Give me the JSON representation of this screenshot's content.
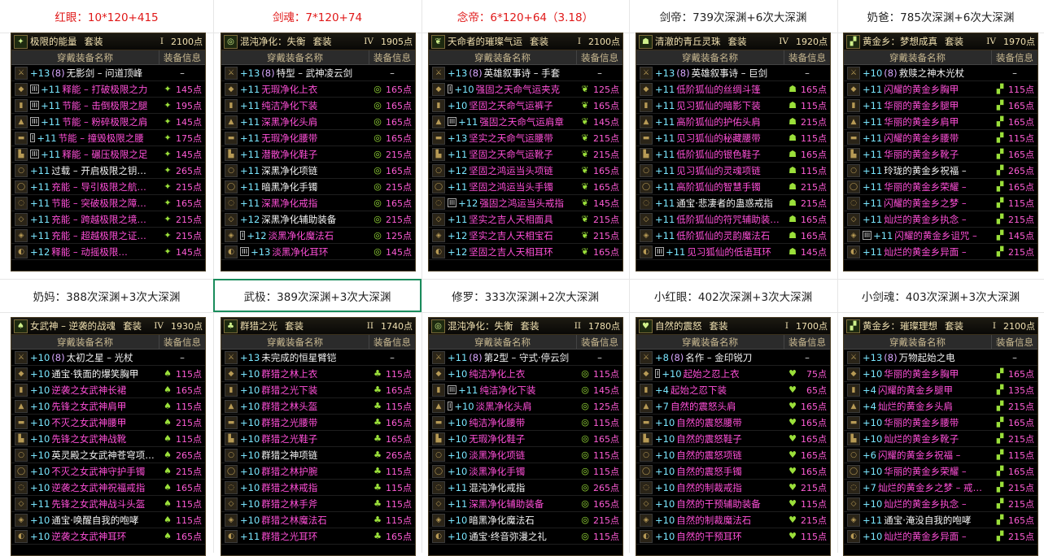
{
  "headers_top": [
    {
      "text": "红眼：10*120+415",
      "red": true
    },
    {
      "text": "剑魂：7*120+74",
      "red": true
    },
    {
      "text": "念帝：6*120+64（3.18）",
      "red": true
    },
    {
      "text": "剑帝：739次深渊+6次大深渊",
      "red": false
    },
    {
      "text": "奶爸：785次深渊+6次大深渊",
      "red": false
    }
  ],
  "headers_mid": [
    {
      "text": "奶妈：388次深渊+3次大深渊",
      "red": false
    },
    {
      "text": "武极：389次深渊+3次大深渊",
      "red": false,
      "selected": true
    },
    {
      "text": "修罗：333次深渊+2次大深渊",
      "red": false
    },
    {
      "text": "小红眼：402次深渊+3次大深渊",
      "red": false
    },
    {
      "text": "小剑魂：403次深渊+3次大深渊",
      "red": false
    }
  ],
  "columns": {
    "name": "穿戴装备名称",
    "info": "装备信息"
  },
  "colors": {
    "set_green": "#9be03a",
    "pink": "#ff4fd8",
    "gold": "#f0e0b0",
    "cyan": "#7ae6ff"
  },
  "panels": [
    {
      "title": "极限的能量",
      "tag": "套装",
      "grade": "I",
      "points": "2100点",
      "icon": "energy-set-icon",
      "rows": [
        {
          "enh": "+13",
          "amp": "(8)",
          "name": "无影剑 – 问道顶峰",
          "color": "white",
          "pts": "–"
        },
        {
          "badge": "III",
          "enh": "+11",
          "name": "释能 – 打破极限之力",
          "color": "pink",
          "pts": "145点"
        },
        {
          "badge": "III",
          "enh": "+11",
          "name": "节能 – 击倒极限之腿",
          "color": "pink",
          "pts": "195点"
        },
        {
          "badge": "III",
          "enh": "+11",
          "name": "节能 – 粉碎极限之肩",
          "color": "pink",
          "pts": "145点"
        },
        {
          "badge": "I",
          "enh": "+11",
          "name": "节能 – 撞毁极限之腰",
          "color": "pink",
          "pts": "175点"
        },
        {
          "badge": "III",
          "enh": "+11",
          "name": "释能 – 碾压极限之足",
          "color": "pink",
          "pts": "145点"
        },
        {
          "enh": "+11",
          "name": "过载 – 开启极限之钥…",
          "color": "white",
          "pts": "265点"
        },
        {
          "enh": "+11",
          "name": "充能 – 导引极限之航…",
          "color": "pink",
          "pts": "215点"
        },
        {
          "enh": "+11",
          "name": "节能 – 突破极限之障…",
          "color": "pink",
          "pts": "165点"
        },
        {
          "enh": "+11",
          "name": "充能 – 跨越极限之境…",
          "color": "pink",
          "pts": "215点"
        },
        {
          "enh": "+11",
          "name": "充能 – 超越极限之证…",
          "color": "pink",
          "pts": "215点"
        },
        {
          "enh": "+12",
          "name": "释能 – 动摇极限…",
          "color": "pink",
          "pts": "145点"
        }
      ]
    },
    {
      "title": "混沌净化：失衡",
      "tag": "套装",
      "grade": "IV",
      "points": "1905点",
      "icon": "chaos-set-icon",
      "rows": [
        {
          "enh": "+13",
          "amp": "(8)",
          "name": "特型 – 武神凌云剑",
          "color": "white",
          "pts": "–"
        },
        {
          "enh": "+11",
          "name": "无瑕净化上衣",
          "color": "pink",
          "pts": "165点"
        },
        {
          "enh": "+11",
          "name": "纯洁净化下装",
          "color": "pink",
          "pts": "165点"
        },
        {
          "enh": "+11",
          "name": "深黑净化头肩",
          "color": "pink",
          "pts": "165点"
        },
        {
          "enh": "+11",
          "name": "无瑕净化腰带",
          "color": "pink",
          "pts": "165点"
        },
        {
          "enh": "+11",
          "name": "潜散净化鞋子",
          "color": "pink",
          "pts": "215点"
        },
        {
          "enh": "+11",
          "name": "深黑净化项链",
          "color": "white",
          "pts": "165点"
        },
        {
          "enh": "+11",
          "name": "暗黑净化手镯",
          "color": "white",
          "pts": "215点"
        },
        {
          "enh": "+11",
          "name": "深黑净化戒指",
          "color": "pink",
          "pts": "165点"
        },
        {
          "enh": "+12",
          "name": "深黑净化辅助装备",
          "color": "white",
          "pts": "215点"
        },
        {
          "badge": "I",
          "enh": "+12",
          "name": "淡黑净化魔法石",
          "color": "pink",
          "pts": "125点"
        },
        {
          "badge": "III",
          "enh": "+13",
          "name": "淡黑净化耳环",
          "color": "pink",
          "pts": "145点"
        }
      ]
    },
    {
      "title": "天命者的璀璨气运",
      "tag": "套装",
      "grade": "I",
      "points": "2100点",
      "icon": "destiny-set-icon",
      "rows": [
        {
          "enh": "+13",
          "amp": "(8)",
          "name": "英雄叙事诗 – 手套",
          "color": "white",
          "pts": "–"
        },
        {
          "badge": "I",
          "enh": "+10",
          "name": "强固之天命气运夹克",
          "color": "pink",
          "pts": "125点"
        },
        {
          "enh": "+10",
          "name": "坚固之天命气运裤子",
          "color": "pink",
          "pts": "165点"
        },
        {
          "badge": "III",
          "enh": "+11",
          "name": "强固之天命气运肩章",
          "color": "pink",
          "pts": "145点"
        },
        {
          "enh": "+13",
          "name": "坚实之天命气运腰带",
          "color": "pink",
          "pts": "215点"
        },
        {
          "enh": "+11",
          "name": "坚固之天命气运靴子",
          "color": "pink",
          "pts": "215点"
        },
        {
          "enh": "+12",
          "name": "坚固之鸿运当头项链",
          "color": "pink",
          "pts": "165点"
        },
        {
          "enh": "+11",
          "name": "坚固之鸿运当头手镯",
          "color": "pink",
          "pts": "165点"
        },
        {
          "badge": "III",
          "enh": "+12",
          "name": "强固之鸿运当头戒指",
          "color": "pink",
          "pts": "145点"
        },
        {
          "enh": "+11",
          "name": "坚实之吉人天相面具",
          "color": "pink",
          "pts": "215点"
        },
        {
          "enh": "+12",
          "name": "坚实之吉人天相宝石",
          "color": "pink",
          "pts": "215点"
        },
        {
          "enh": "+12",
          "name": "坚固之吉人天相耳环",
          "color": "pink",
          "pts": "165点"
        }
      ]
    },
    {
      "title": "清澈的青丘灵珠",
      "tag": "套装",
      "grade": "IV",
      "points": "1920点",
      "icon": "fox-set-icon",
      "rows": [
        {
          "enh": "+13",
          "amp": "(8)",
          "name": "英雄叙事诗 – 巨剑",
          "color": "white",
          "pts": "–"
        },
        {
          "enh": "+11",
          "name": "低阶狐仙的丝绸斗篷",
          "color": "pink",
          "pts": "165点"
        },
        {
          "enh": "+11",
          "name": "见习狐仙的暗影下装",
          "color": "pink",
          "pts": "115点"
        },
        {
          "enh": "+11",
          "name": "高阶狐仙的护佑头肩",
          "color": "pink",
          "pts": "215点"
        },
        {
          "enh": "+11",
          "name": "见习狐仙的秘藏腰带",
          "color": "pink",
          "pts": "115点"
        },
        {
          "enh": "+11",
          "name": "低阶狐仙的银色鞋子",
          "color": "pink",
          "pts": "165点"
        },
        {
          "enh": "+11",
          "name": "见习狐仙的灵魂项链",
          "color": "pink",
          "pts": "115点"
        },
        {
          "enh": "+11",
          "name": "高阶狐仙的智慧手镯",
          "color": "pink",
          "pts": "215点"
        },
        {
          "enh": "+11",
          "name": "通宝·悲凄者的蛊惑戒指",
          "color": "white",
          "pts": "215点"
        },
        {
          "enh": "+11",
          "name": "低阶狐仙的符咒辅助装…",
          "color": "pink",
          "pts": "165点"
        },
        {
          "enh": "+11",
          "name": "低阶狐仙的灵韵魔法石",
          "color": "pink",
          "pts": "165点"
        },
        {
          "badge": "III",
          "enh": "+11",
          "name": "见习狐仙的低语耳环",
          "color": "pink",
          "pts": "145点"
        }
      ]
    },
    {
      "title": "黄金乡：梦想成真",
      "tag": "套装",
      "grade": "IV",
      "points": "1970点",
      "icon": "gold-set-icon",
      "rows": [
        {
          "enh": "+10",
          "amp": "(8)",
          "name": "救赎之神木光杖",
          "color": "white",
          "pts": "–"
        },
        {
          "enh": "+11",
          "name": "闪耀的黄金乡胸甲",
          "color": "pink",
          "pts": "115点"
        },
        {
          "enh": "+11",
          "name": "华丽的黄金乡腿甲",
          "color": "pink",
          "pts": "165点"
        },
        {
          "enh": "+11",
          "name": "华丽的黄金乡肩甲",
          "color": "pink",
          "pts": "165点"
        },
        {
          "enh": "+11",
          "name": "闪耀的黄金乡腰带",
          "color": "pink",
          "pts": "115点"
        },
        {
          "enh": "+11",
          "name": "华丽的黄金乡靴子",
          "color": "pink",
          "pts": "165点"
        },
        {
          "enh": "+11",
          "name": "玲珑的黄金乡祝福 –",
          "color": "white",
          "pts": "265点"
        },
        {
          "enh": "+11",
          "name": "华丽的黄金乡荣耀 –",
          "color": "pink",
          "pts": "165点"
        },
        {
          "enh": "+11",
          "name": "闪耀的黄金乡之梦 –",
          "color": "pink",
          "pts": "115点"
        },
        {
          "enh": "+11",
          "name": "灿烂的黄金乡执念 –",
          "color": "pink",
          "pts": "215点"
        },
        {
          "badge": "III",
          "enh": "+11",
          "name": "闪耀的黄金乡诅咒 –",
          "color": "pink",
          "pts": "145点"
        },
        {
          "enh": "+11",
          "name": "灿烂的黄金乡异面 –",
          "color": "pink",
          "pts": "215点"
        }
      ]
    },
    {
      "title": "女武神 – 逆袭的战魂",
      "tag": "套装",
      "grade": "IV",
      "points": "1930点",
      "icon": "valkyrie-set-icon",
      "rows": [
        {
          "enh": "+10",
          "amp": "(8)",
          "name": "太初之星 – 光杖",
          "color": "white",
          "pts": "–"
        },
        {
          "enh": "+10",
          "name": "通宝·铁面的爆笑胸甲",
          "color": "white",
          "pts": "115点"
        },
        {
          "enh": "+10",
          "name": "逆袭之女武神长裙",
          "color": "pink",
          "pts": "165点"
        },
        {
          "enh": "+10",
          "name": "先锋之女武神肩甲",
          "color": "pink",
          "pts": "115点"
        },
        {
          "enh": "+10",
          "name": "不灭之女武神腰甲",
          "color": "pink",
          "pts": "215点"
        },
        {
          "enh": "+10",
          "name": "先锋之女武神战靴",
          "color": "pink",
          "pts": "115点"
        },
        {
          "enh": "+10",
          "name": "英灵殿之女武神苍穹项…",
          "color": "white",
          "pts": "265点"
        },
        {
          "enh": "+10",
          "name": "不灭之女武神守护手镯",
          "color": "pink",
          "pts": "215点"
        },
        {
          "enh": "+10",
          "name": "逆袭之女武神祝福戒指",
          "color": "pink",
          "pts": "165点"
        },
        {
          "enh": "+11",
          "name": "先锋之女武神战斗头盔",
          "color": "pink",
          "pts": "115点"
        },
        {
          "enh": "+10",
          "name": "通宝·唤醒自我的咆哮",
          "color": "white",
          "pts": "115点"
        },
        {
          "enh": "+10",
          "name": "逆袭之女武神耳环",
          "color": "pink",
          "pts": "165点"
        }
      ]
    },
    {
      "title": "群猎之光",
      "tag": "套装",
      "grade": "II",
      "points": "1740点",
      "icon": "hunt-set-icon",
      "rows": [
        {
          "enh": "+13",
          "name": "未完成的恒星臂铠",
          "color": "white",
          "pts": "–"
        },
        {
          "enh": "+10",
          "name": "群猎之林上衣",
          "color": "pink",
          "pts": "115点"
        },
        {
          "enh": "+10",
          "name": "群猎之光下装",
          "color": "pink",
          "pts": "165点"
        },
        {
          "enh": "+10",
          "name": "群猎之林头盔",
          "color": "pink",
          "pts": "115点"
        },
        {
          "enh": "+10",
          "name": "群猎之光腰带",
          "color": "pink",
          "pts": "165点"
        },
        {
          "enh": "+10",
          "name": "群猎之光鞋子",
          "color": "pink",
          "pts": "165点"
        },
        {
          "enh": "+10",
          "name": "群猎之神项链",
          "color": "white",
          "pts": "265点"
        },
        {
          "enh": "+10",
          "name": "群猎之林护腕",
          "color": "pink",
          "pts": "115点"
        },
        {
          "enh": "+10",
          "name": "群猎之林戒指",
          "color": "pink",
          "pts": "115点"
        },
        {
          "enh": "+10",
          "name": "群猎之林手斧",
          "color": "pink",
          "pts": "115点"
        },
        {
          "enh": "+10",
          "name": "群猎之林魔法石",
          "color": "pink",
          "pts": "115点"
        },
        {
          "enh": "+11",
          "name": "群猎之光耳环",
          "color": "pink",
          "pts": "165点"
        }
      ]
    },
    {
      "title": "混沌净化：失衡",
      "tag": "套装",
      "grade": "II",
      "points": "1780点",
      "icon": "chaos-set-icon",
      "rows": [
        {
          "enh": "+11",
          "amp": "(8)",
          "name": "第2型 – 守式·停云剑",
          "color": "white",
          "pts": "–"
        },
        {
          "enh": "+10",
          "name": "纯洁净化上衣",
          "color": "pink",
          "pts": "115点"
        },
        {
          "badge": "III",
          "enh": "+11",
          "name": "纯洁净化下装",
          "color": "pink",
          "pts": "145点"
        },
        {
          "badge": "I",
          "enh": "+10",
          "name": "淡黑净化头肩",
          "color": "pink",
          "pts": "125点"
        },
        {
          "enh": "+10",
          "name": "纯洁净化腰带",
          "color": "pink",
          "pts": "115点"
        },
        {
          "enh": "+10",
          "name": "无瑕净化鞋子",
          "color": "pink",
          "pts": "165点"
        },
        {
          "enh": "+10",
          "name": "淡黑净化项链",
          "color": "pink",
          "pts": "115点"
        },
        {
          "enh": "+10",
          "name": "淡黑净化手镯",
          "color": "pink",
          "pts": "115点"
        },
        {
          "enh": "+11",
          "name": "混沌净化戒指",
          "color": "white",
          "pts": "265点"
        },
        {
          "enh": "+11",
          "name": "深黑净化辅助装备",
          "color": "pink",
          "pts": "165点"
        },
        {
          "enh": "+10",
          "name": "暗黑净化魔法石",
          "color": "white",
          "pts": "215点"
        },
        {
          "enh": "+10",
          "name": "通宝·终音弥漫之礼",
          "color": "white",
          "pts": "115点"
        }
      ]
    },
    {
      "title": "自然的震怒",
      "tag": "套装",
      "grade": "I",
      "points": "1700点",
      "icon": "nature-set-icon",
      "rows": [
        {
          "enh": "+8",
          "amp": "(8)",
          "name": "名作 – 金印锐刀",
          "color": "white",
          "pts": "–"
        },
        {
          "badge": "I",
          "enh": "+10",
          "name": "起始之忍上衣",
          "color": "pink",
          "pts": "75点"
        },
        {
          "enh": "+4",
          "name": "起始之忍下装",
          "color": "pink",
          "pts": "65点"
        },
        {
          "enh": "+7",
          "name": "自然的震怒头肩",
          "color": "pink",
          "pts": "165点"
        },
        {
          "enh": "+10",
          "name": "自然的震怒腰带",
          "color": "pink",
          "pts": "165点"
        },
        {
          "enh": "+10",
          "name": "自然的震怒鞋子",
          "color": "pink",
          "pts": "165点"
        },
        {
          "enh": "+10",
          "name": "自然的震怒项链",
          "color": "pink",
          "pts": "165点"
        },
        {
          "enh": "+10",
          "name": "自然的震怒手镯",
          "color": "pink",
          "pts": "165点"
        },
        {
          "enh": "+10",
          "name": "自然的制裁戒指",
          "color": "pink",
          "pts": "215点"
        },
        {
          "enh": "+10",
          "name": "自然的干预辅助装备",
          "color": "pink",
          "pts": "115点"
        },
        {
          "enh": "+10",
          "name": "自然的制裁魔法石",
          "color": "pink",
          "pts": "215点"
        },
        {
          "enh": "+10",
          "name": "自然的干预耳环",
          "color": "pink",
          "pts": "115点"
        }
      ]
    },
    {
      "title": "黄金乡：璀璨理想",
      "tag": "套装",
      "grade": "I",
      "points": "2100点",
      "icon": "gold-set-icon",
      "rows": [
        {
          "enh": "+13",
          "amp": "(8)",
          "name": "万物起始之电",
          "color": "white",
          "pts": "–"
        },
        {
          "enh": "+10",
          "name": "华丽的黄金乡胸甲",
          "color": "pink",
          "pts": "165点"
        },
        {
          "enh": "+4",
          "name": "闪耀的黄金乡腿甲",
          "color": "pink",
          "pts": "135点"
        },
        {
          "enh": "+4",
          "name": "灿烂的黄金乡头肩",
          "color": "pink",
          "pts": "215点"
        },
        {
          "enh": "+10",
          "name": "华丽的黄金乡腰带",
          "color": "pink",
          "pts": "165点"
        },
        {
          "enh": "+10",
          "name": "灿烂的黄金乡靴子",
          "color": "pink",
          "pts": "215点"
        },
        {
          "enh": "+6",
          "name": "闪耀的黄金乡祝福 –",
          "color": "pink",
          "pts": "115点"
        },
        {
          "enh": "+10",
          "name": "华丽的黄金乡荣耀 –",
          "color": "pink",
          "pts": "165点"
        },
        {
          "enh": "+7",
          "name": "灿烂的黄金乡之梦 – 戒…",
          "color": "pink",
          "pts": "215点"
        },
        {
          "enh": "+10",
          "name": "灿烂的黄金乡执念 –",
          "color": "pink",
          "pts": "215点"
        },
        {
          "enh": "+11",
          "name": "通宝·淹没自我的咆哮",
          "color": "white",
          "pts": "165点"
        },
        {
          "enh": "+10",
          "name": "灿烂的黄金乡异面 –",
          "color": "pink",
          "pts": "215点"
        }
      ]
    }
  ]
}
